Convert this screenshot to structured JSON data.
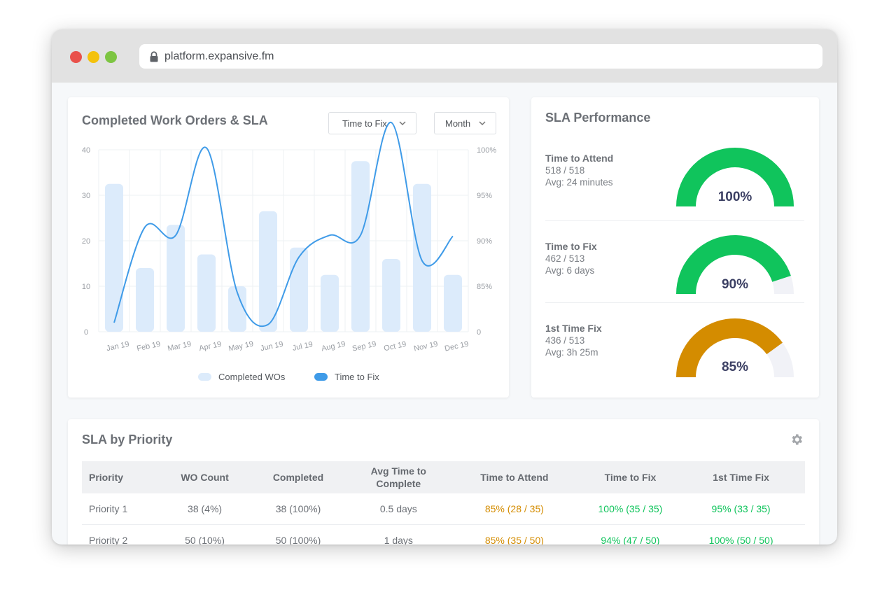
{
  "browser": {
    "url": "platform.expansive.fm",
    "dots": {
      "red": "#e9514b",
      "yellow": "#f4c20d",
      "green": "#7dc542"
    }
  },
  "wo_card": {
    "title": "Completed Work Orders & SLA",
    "dropdown_metric": "Time to Fix",
    "dropdown_period": "Month",
    "legend": {
      "bars": "Completed WOs",
      "line": "Time to Fix"
    }
  },
  "chart_data": {
    "type": "bar",
    "categories": [
      "Jan 19",
      "Feb 19",
      "Mar 19",
      "Apr 19",
      "May 19",
      "Jun 19",
      "Jul 19",
      "Aug 19",
      "Sep 19",
      "Oct 19",
      "Nov 19",
      "Dec 19"
    ],
    "series": [
      {
        "name": "Completed WOs",
        "type": "bar",
        "axis": "left",
        "color": "#dcebfb",
        "values": [
          32.5,
          14,
          23.5,
          17,
          10,
          26.5,
          18.5,
          12.5,
          37.5,
          16,
          32.5,
          12.5
        ]
      },
      {
        "name": "Time to Fix",
        "type": "line",
        "axis": "right",
        "color": "#3f9be8",
        "values": [
          81,
          91.5,
          90.6,
          100.2,
          84.3,
          80.8,
          88.2,
          90.6,
          90.6,
          103,
          87.8,
          90.5
        ]
      }
    ],
    "y_left": {
      "ticks": [
        "0",
        "10",
        "20",
        "30",
        "40"
      ],
      "range": [
        0,
        40
      ]
    },
    "y_right": {
      "ticks": [
        "0",
        "85%",
        "90%",
        "95%",
        "100%"
      ],
      "range": [
        80,
        100
      ]
    },
    "grid": true,
    "legend_position": "bottom"
  },
  "sla_card": {
    "title": "SLA Performance",
    "items": [
      {
        "name": "Time to Attend",
        "ratio": "518 / 518",
        "avg": "Avg: 24 minutes",
        "value": "100%",
        "fraction": 1.0,
        "color": "#10c45c"
      },
      {
        "name": "Time to Fix",
        "ratio": "462 / 513",
        "avg": "Avg: 6 days",
        "value": "90%",
        "fraction": 0.9,
        "color": "#10c45c"
      },
      {
        "name": "1st Time Fix",
        "ratio": "436 / 513",
        "avg": "Avg: 3h 25m",
        "value": "85%",
        "fraction": 0.8,
        "color": "#d48c00"
      }
    ],
    "track_color": "#f1f2f7"
  },
  "priority_card": {
    "title": "SLA by Priority",
    "headers": [
      "Priority",
      "WO Count",
      "Completed",
      "Avg Time to Complete",
      "Time to Attend",
      "Time to Fix",
      "1st Time Fix"
    ],
    "rows": [
      [
        "Priority 1",
        "38 (4%)",
        "38 (100%)",
        "0.5 days",
        "85% (28 / 35)",
        "100% (35 / 35)",
        "95% (33 / 35)"
      ],
      [
        "Priority 2",
        "50 (10%)",
        "50 (100%)",
        "1 days",
        "85% (35 / 50)",
        "94% (47 / 50)",
        "100% (50 / 50)"
      ]
    ]
  }
}
